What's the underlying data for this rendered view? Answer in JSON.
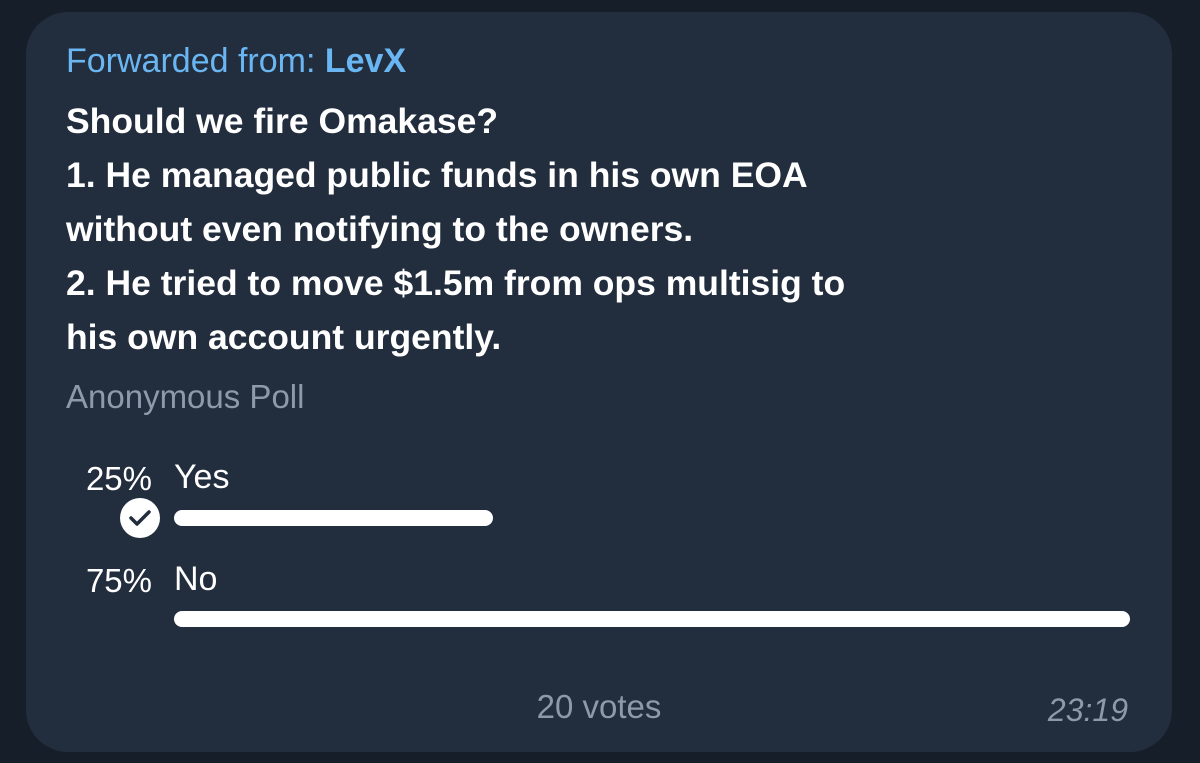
{
  "message": {
    "forward_prefix": "Forwarded from: ",
    "forward_name": "LevX",
    "question": "Should we fire Omakase?\n1. He managed public funds in his own EOA\nwithout even notifying to the owners.\n2. He tried to move $1.5m from ops multisig to\nhis own account urgently.",
    "time": "23:19"
  },
  "poll": {
    "type_label": "Anonymous Poll",
    "total_votes": "20 votes",
    "bar_color": "#ffffff",
    "options": [
      {
        "percent_label": "25%",
        "label": "Yes",
        "fraction": 0.25,
        "chosen": true,
        "check_icon": "check-circle-icon"
      },
      {
        "percent_label": "75%",
        "label": "No",
        "fraction": 0.75,
        "chosen": false
      }
    ]
  },
  "colors": {
    "background": "#161e29",
    "bubble": "#222d3d",
    "forward_accent": "#6ab6f2",
    "muted_text": "#8e9aaa"
  }
}
